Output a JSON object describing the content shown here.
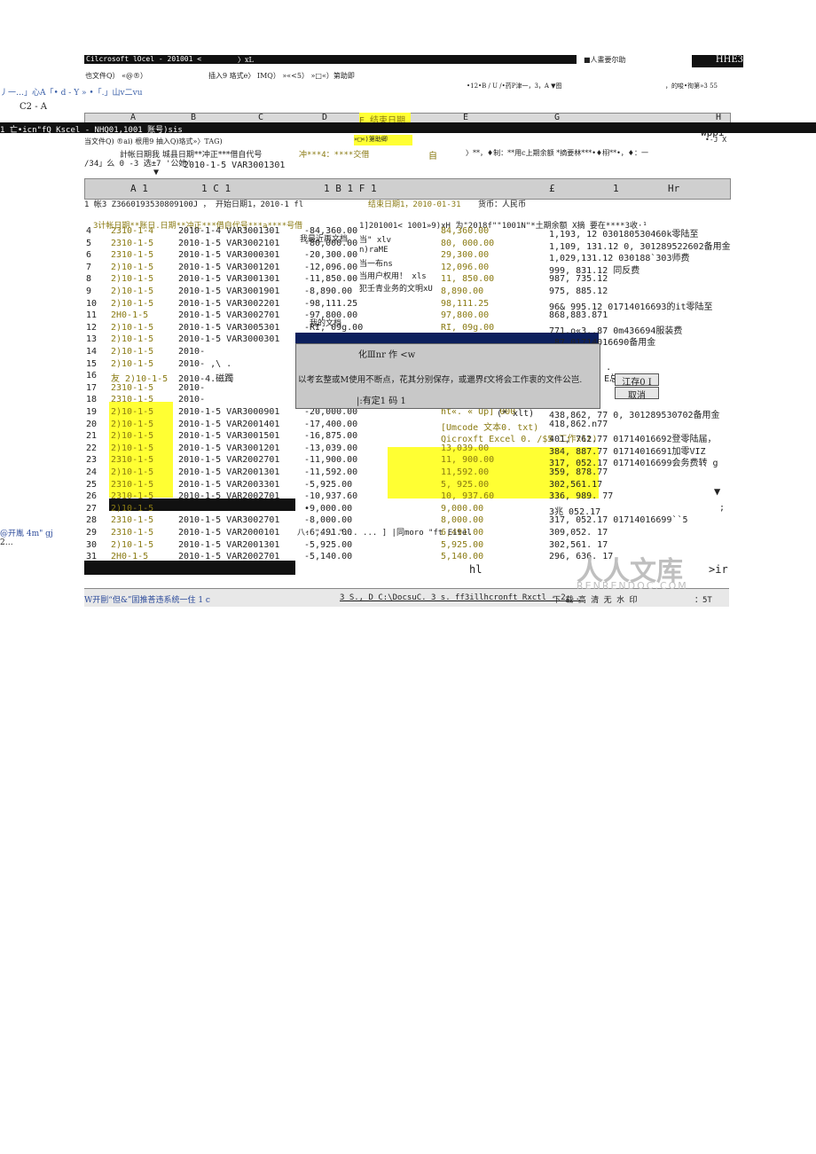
{
  "titlebar": {
    "title": "Cilcrosoft lOcel - 201001 <",
    "title_ext": "〉xL",
    "right_text": "■人畫要尔助",
    "right_badge": "HHE3"
  },
  "menubar": {
    "file": "也文件Q） «@®）",
    "insert": "插入9 珞式e〉 IMQ） »«<5） »□«）第助即",
    "format_bar": "•12•B / U /•药P津一，3，A ▼图",
    "right": "，的唆•徇第»3 55"
  },
  "toolbar2": {
    "left": "丿一…」心A「• d - Y » •「.」山v二vu"
  },
  "namebox": {
    "ref": "C2 - A"
  },
  "sheet": {
    "col_headers": [
      "A",
      "B",
      "C",
      "D",
      "E",
      "F",
      "G",
      "H"
    ],
    "yellow_header": "E 结束日期",
    "inner_title": "1 亡•icn\"fQ Kscel - NHQ01,1001 账号)sis",
    "inner_menu": "当文件Q) ®ai) 根用9 抽入Q)珞式»〉TAG)",
    "inner_menu2": "冲***4：****交借",
    "help_badge": "»□«)第助卿",
    "self": "自",
    "formula_hint": "〉**，♦制：**用c上期余额 *摘要林***•♦栩**•，♦：一",
    "dup_row1": "計帐日期我 城县日期**冲正***借自代号",
    "dup_row2": "2010-1-5 VAR3001301",
    "dup_row3": "/34」么 0 -3 选±7 '公她'",
    "second_header": [
      "A 1",
      "1 C 1",
      "1 B 1 F 1",
      "£",
      "1",
      "Hr"
    ],
    "row1_text": "1 帐3 Z3660193530809100J ， 开始日期1，2010-1 fl",
    "row1_text2": "结束日期1，2010-01-31",
    "row1_text3": "货币：人民币",
    "row3_text": "3计帐日期**账日.日期**冲正***借自代号***a****号借",
    "row3_text2": "1]201001< 1001»9)xH 为\"2018f\"\"1001N\"*土期余额 X摘 要在****3收·¹",
    "sidebar_notes": [
      "我最近再文档",
      "当\" xlv",
      "n)raME",
      "当一布ns",
      "当用户权用！ xls",
      "犯壬青业务的文明xU"
    ],
    "my_docs": "我的文档",
    "rows": [
      {
        "n": "4",
        "a": "2310-1-4",
        "b": "2010-1-4 VAR3001301",
        "d": "-84,360.00",
        "e": "84,360.00",
        "g": "1,193,   12 030180530460k零陆至"
      },
      {
        "n": "5",
        "a": "2310-1-5",
        "b": "2010-1-5 VAR3002101",
        "d": "-80,000.00",
        "e": "80, 000.00",
        "g": "1,109, 131.12 0, 301289522602备用金"
      },
      {
        "n": "6",
        "a": "2310-1-5",
        "b": "2010-1-5 VAR3000301",
        "d": "-20,300.00",
        "e": "29,300.00",
        "g": "1,029,131.12 030188`303师费"
      },
      {
        "n": "7",
        "a": "2)10-1-5",
        "b": "2010-1-5 VAR3001201",
        "d": "-12,096.00",
        "e": "12,096.00",
        "g": "999, 831.12       同反费"
      },
      {
        "n": "8",
        "a": "2)10-1-5",
        "b": "2010-1-5 VAR3001301",
        "d": "-11,850.00",
        "e": "11, 850.00",
        "g": "987, 735.12"
      },
      {
        "n": "9",
        "a": "2)10-1-5",
        "b": "2010-1-5 VAR3001901",
        "d": "-8,890.00",
        "e": "8,890.00",
        "g": "975, 885.12"
      },
      {
        "n": "10",
        "a": "2)10-1-5",
        "b": "2010-1-5 VAR3002201",
        "d": "-98,111.25",
        "e": "98,111.25",
        "g": "96& 995.12 01714016693的it零陆至"
      },
      {
        "n": "11",
        "a": "2H0-1-5",
        "b": "2010-1-5 VAR3002701",
        "d": "-97,800.00",
        "e": "97,800.00",
        "g": "868,883.871"
      },
      {
        "n": "12",
        "a": "2)10-1-5",
        "b": "2010-1-5 VAR3005301",
        "d": "-RI, 09g.00",
        "e": "RI, 09g.00",
        "g": "771.o«3..87 0m436694服装费"
      },
      {
        "n": "13",
        "a": "2)10-1-5",
        "b": "2010-1-5 VAR3000301",
        "d": "",
        "e": "",
        "g": ".87 01714016690备用金"
      },
      {
        "n": "14",
        "a": "2)10-1-5",
        "b": "2010-",
        "d": "",
        "e": "",
        "g": "87"
      },
      {
        "n": "15",
        "a": "2)10-1-5",
        "b": "2010- ,\\ .",
        "d": "",
        "e": "",
        "g": "87        ?零陆届，."
      },
      {
        "n": "16",
        "a": "友 2)10-1-5",
        "b": "2010-4.磁躅",
        "d": "",
        "e": "",
        "g": "37  江存0 I     E总平机W"
      },
      {
        "n": "17",
        "a": "2310-1-5",
        "b": "2010-",
        "d": "",
        "e": "",
        "g": "77        取声"
      },
      {
        "n": "18",
        "a": "2310-1-5",
        "b": "2010-",
        "d": "",
        "e": "",
        "g": "77"
      },
      {
        "n": "19",
        "a": "2)10-1-5",
        "b": "2010-1-5 VAR3000901",
        "d": "-20,000.00",
        "e": "ht«. « Up] 000",
        "g": "438,862, 77 0, 301289530702备用金"
      },
      {
        "n": "20",
        "a": "2)10-1-5",
        "b": "2010-1-5 VAR2001401",
        "d": "-17,400.00",
        "e": "[Umcode 文本0. txt)",
        "g": "418,862.n77"
      },
      {
        "n": "21",
        "a": "2)10-1-5",
        "b": "2010-1-5 VAR3001501",
        "d": "-16,875.00",
        "e": "Qicroxft Excel 0. /$5 工作xlt)",
        "g": "401, 762.77 01714016692登零陆届，"
      },
      {
        "n": "22",
        "a": "2)10-1-5",
        "b": "2010-1-5 VAR3001201",
        "d": "-13,039.00",
        "e": "13,039.00",
        "g": "384, 887.77 01714016691加零VIZ"
      },
      {
        "n": "23",
        "a": "2310-1-5",
        "b": "2010-1-5 VAR2002701",
        "d": "-11,900.00",
        "e": "11, 900.00",
        "g": "317, 052.17 01714016699会务费转 g"
      },
      {
        "n": "24",
        "a": "2)10-1-5",
        "b": "2010-1-5 VAR2001301",
        "d": "-11,592.00",
        "e": "11,592.00",
        "g": "359, 878.77"
      },
      {
        "n": "25",
        "a": "2310-1-5",
        "b": "2010-1-5 VAR2003301",
        "d": "-5,925.00",
        "e": "5, 925.00",
        "g": "302,561.17"
      },
      {
        "n": "26",
        "a": "2310-1-5",
        "b": "2010-1-5 VAR2002701",
        "d": "-10,937.60",
        "e": "10, 937.60",
        "g": "336, 989. 77"
      },
      {
        "n": "27",
        "a": "2)10-1-5",
        "b": "",
        "d": "•9,000.00",
        "e": "9,000.00",
        "g": "3兆 052.17"
      },
      {
        "n": "28",
        "a": "2310-1-5",
        "b": "2010-1-5 VAR3002701",
        "d": "-8,000.00",
        "e": "8,000.00",
        "g": "317, 052.17 01714016699``5"
      },
      {
        "n": "29",
        "a": "2310-1-5",
        "b": "2010-1-5 VAR2000101",
        "d": "-6,491.00",
        "e": "6,491.00",
        "g": "309,052. 17"
      },
      {
        "n": "30",
        "a": "2)10-1-5",
        "b": "2010-1-5 VAR2001301",
        "d": "-5,925.00",
        "e": "5,925.00",
        "g": "302,561. 17"
      },
      {
        "n": "31",
        "a": "2H0-1-5",
        "b": "2010-1-5 VAR2002701",
        "d": "-5,140.00",
        "e": "5,140.00",
        "g": "296, 636. 17"
      }
    ]
  },
  "dialog": {
    "title": "化Ⅲnr 作 <w",
    "message": "以考玄整或M使用不断点，花其分别保存，或邋界f文将会工作衷的文件公岂.",
    "checkbox_label": "|:有定1 码 1",
    "save_button": "江存0 I",
    "cancel_button": "取消"
  },
  "file_type_list": {
    "title": "文件类型",
    "items": [
      "ht«. « Up] 000",
      "[Umcode 文本0. txt)",
      "Qicroxft Excel 0. /$5 工作xlt)"
    ],
    "tag": "(* xlt)"
  },
  "left_margin": {
    "open_text": "@开胤 4m\"  gj",
    "ellipsis": "2…"
  },
  "footer": {
    "left": "W开剾“但&”囯推荅违系统一住 1  c",
    "path": "3 S., D C:\\DocsuC. 3 s. ff3illhcronft Rxctl - 2...",
    "right_text": "下 载 高 清 无 水 印",
    "page": "：5T",
    "hl": "hl",
    "ir": ">ir",
    "bottom_row_text": "八: \"... \"... ...  ] |同moro \"ft Eitel"
  },
  "watermark": {
    "cn": "人人文库",
    "en": "RENRENDOC.COM"
  },
  "misc": {
    "wppi": "wppi",
    "jx": "•-J X",
    "dots": "◆",
    "arrow": "▼",
    "semi": ";"
  }
}
